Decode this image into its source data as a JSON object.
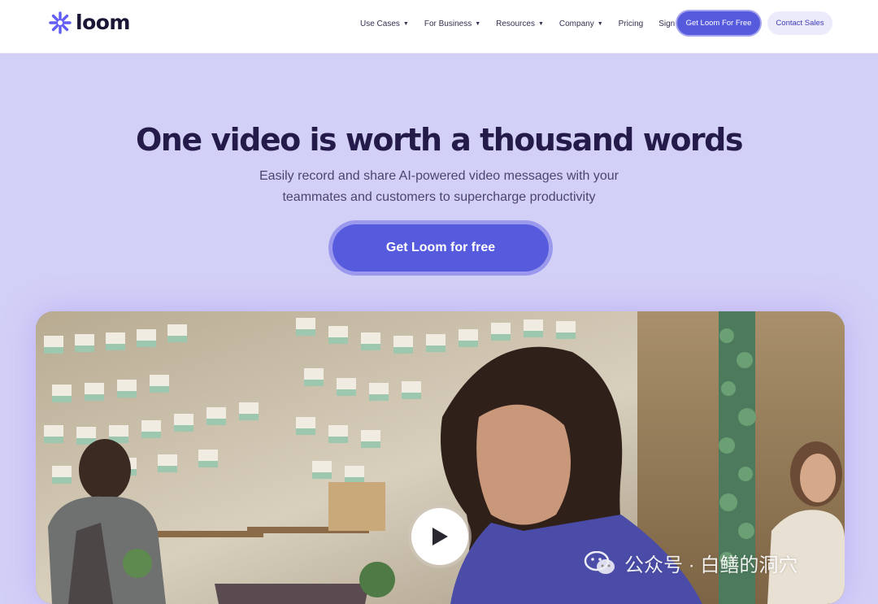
{
  "brand": {
    "name": "loom",
    "color": "#625df5"
  },
  "nav": {
    "items": [
      {
        "label": "Use Cases",
        "dropdown": true
      },
      {
        "label": "For Business",
        "dropdown": true
      },
      {
        "label": "Resources",
        "dropdown": true
      },
      {
        "label": "Company",
        "dropdown": true
      },
      {
        "label": "Pricing",
        "dropdown": false
      },
      {
        "label": "Sign In",
        "dropdown": false
      }
    ],
    "primary_button": "Get Loom For Free",
    "secondary_button": "Contact Sales"
  },
  "hero": {
    "title": "One video is worth a thousand words",
    "subtitle_line1": "Easily record and share AI-powered video messages with your",
    "subtitle_line2": "teammates and customers to supercharge productivity",
    "cta": "Get Loom for free"
  },
  "video": {
    "play_icon": "play-icon"
  },
  "watermark": {
    "text": "公众号 · 白鳝的洞穴",
    "icon": "wechat-icon"
  },
  "colors": {
    "accent": "#565add",
    "hero_bg": "#d3d0f7",
    "title": "#241b4a"
  }
}
